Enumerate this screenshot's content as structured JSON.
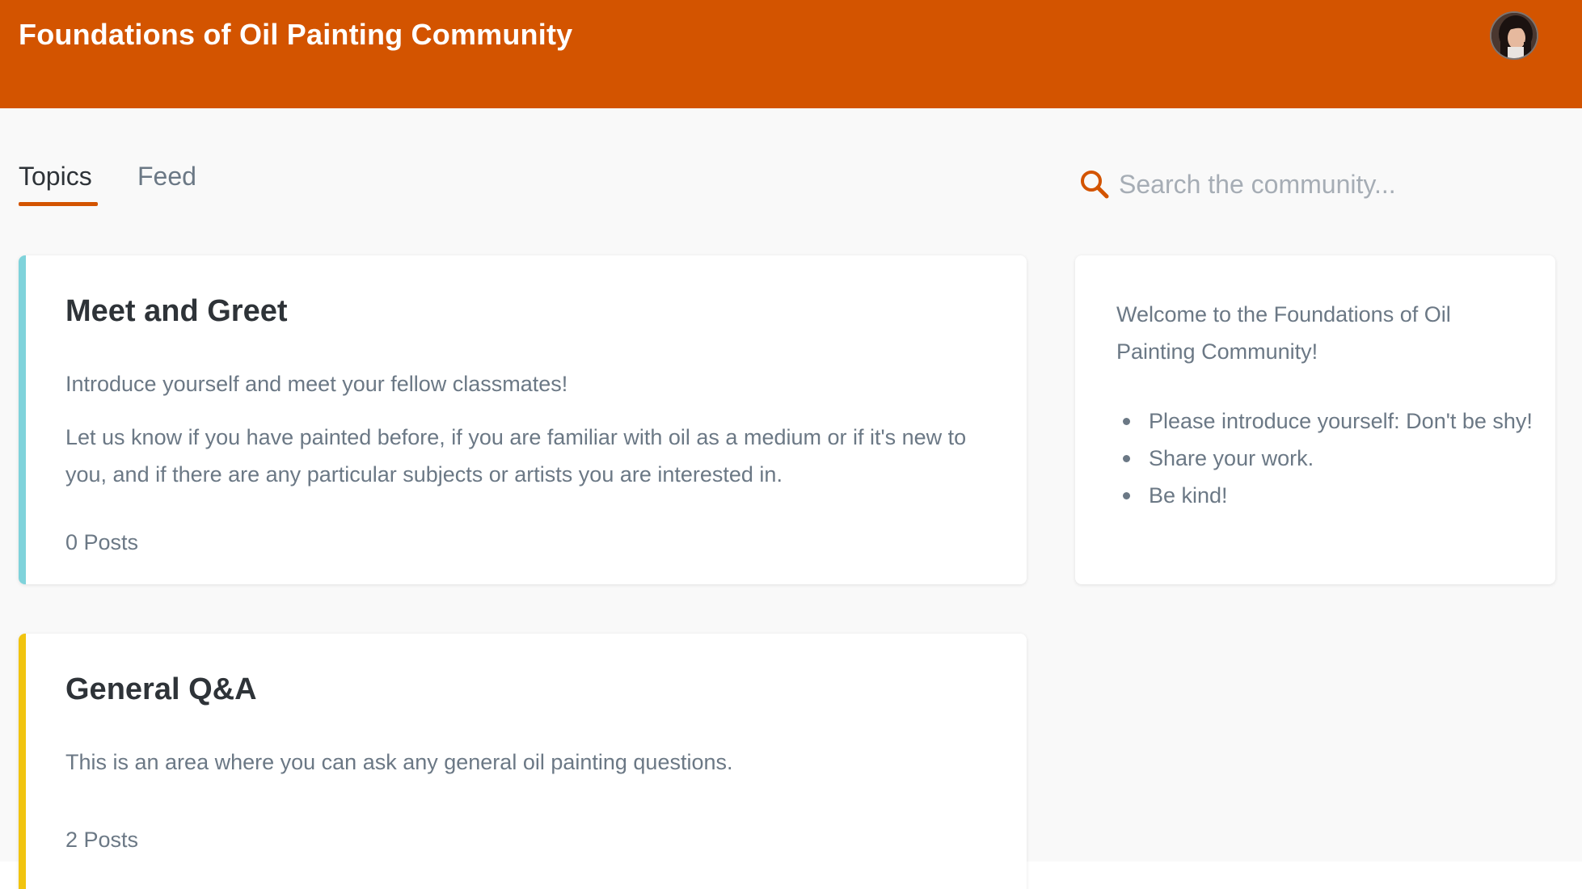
{
  "header": {
    "title": "Foundations of Oil Painting Community",
    "background_color": "#d35400"
  },
  "tabs": [
    {
      "label": "Topics",
      "active": true
    },
    {
      "label": "Feed",
      "active": false
    }
  ],
  "search": {
    "placeholder": "Search the community...",
    "icon": "search-icon"
  },
  "topics": [
    {
      "title": "Meet and Greet",
      "accent_color": "#7fd3db",
      "paragraphs": [
        "Introduce yourself and meet your fellow classmates!",
        "Let us know if you have painted before, if you are familiar with oil as a medium or if it's new to you, and if there are any particular subjects or artists you are interested in."
      ],
      "posts": "0 Posts"
    },
    {
      "title": "General Q&A",
      "accent_color": "#f1c40f",
      "paragraphs": [
        "This is an area where you can ask any general oil painting questions."
      ],
      "posts": "2 Posts"
    }
  ],
  "welcome": {
    "text": "Welcome to the Foundations of Oil Painting Community!",
    "items": [
      "Please introduce yourself: Don't be shy!",
      "Share your work.",
      "Be kind!"
    ]
  },
  "colors": {
    "accent": "#d35400",
    "page_background": "#f9f9f9",
    "text_muted": "#6b7885"
  }
}
